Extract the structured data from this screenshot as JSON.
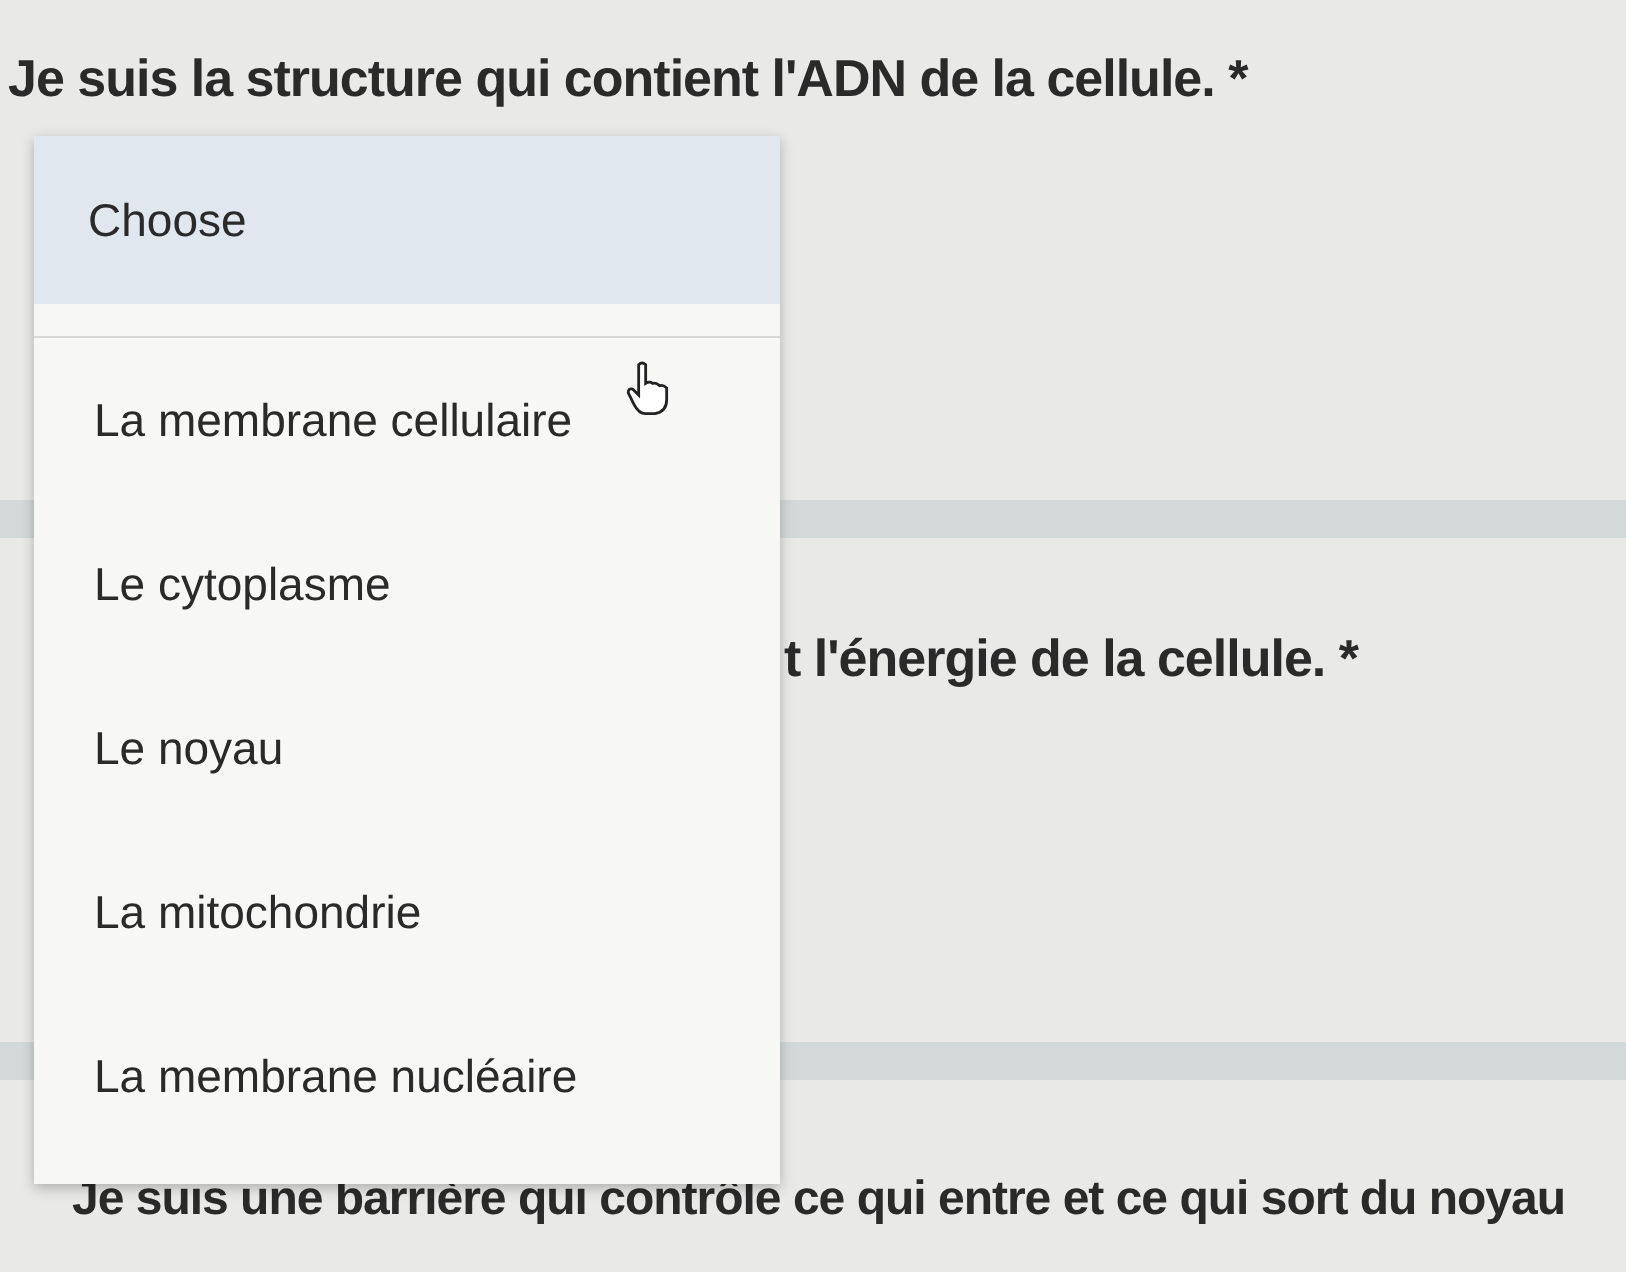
{
  "questions": [
    {
      "title": "Je suis la structure qui contient l'ADN de la cellule. *"
    },
    {
      "title": "t l'énergie de la cellule. *"
    },
    {
      "title": "Je suis une barrière qui contrôle ce qui entre et ce qui sort du noyau"
    }
  ],
  "dropdown": {
    "options": [
      {
        "label": "Choose",
        "selected": true
      },
      {
        "label": "La membrane cellulaire",
        "selected": false
      },
      {
        "label": "Le cytoplasme",
        "selected": false
      },
      {
        "label": "Le noyau",
        "selected": false
      },
      {
        "label": "La mitochondrie",
        "selected": false
      },
      {
        "label": "La membrane nucléaire",
        "selected": false
      }
    ]
  }
}
